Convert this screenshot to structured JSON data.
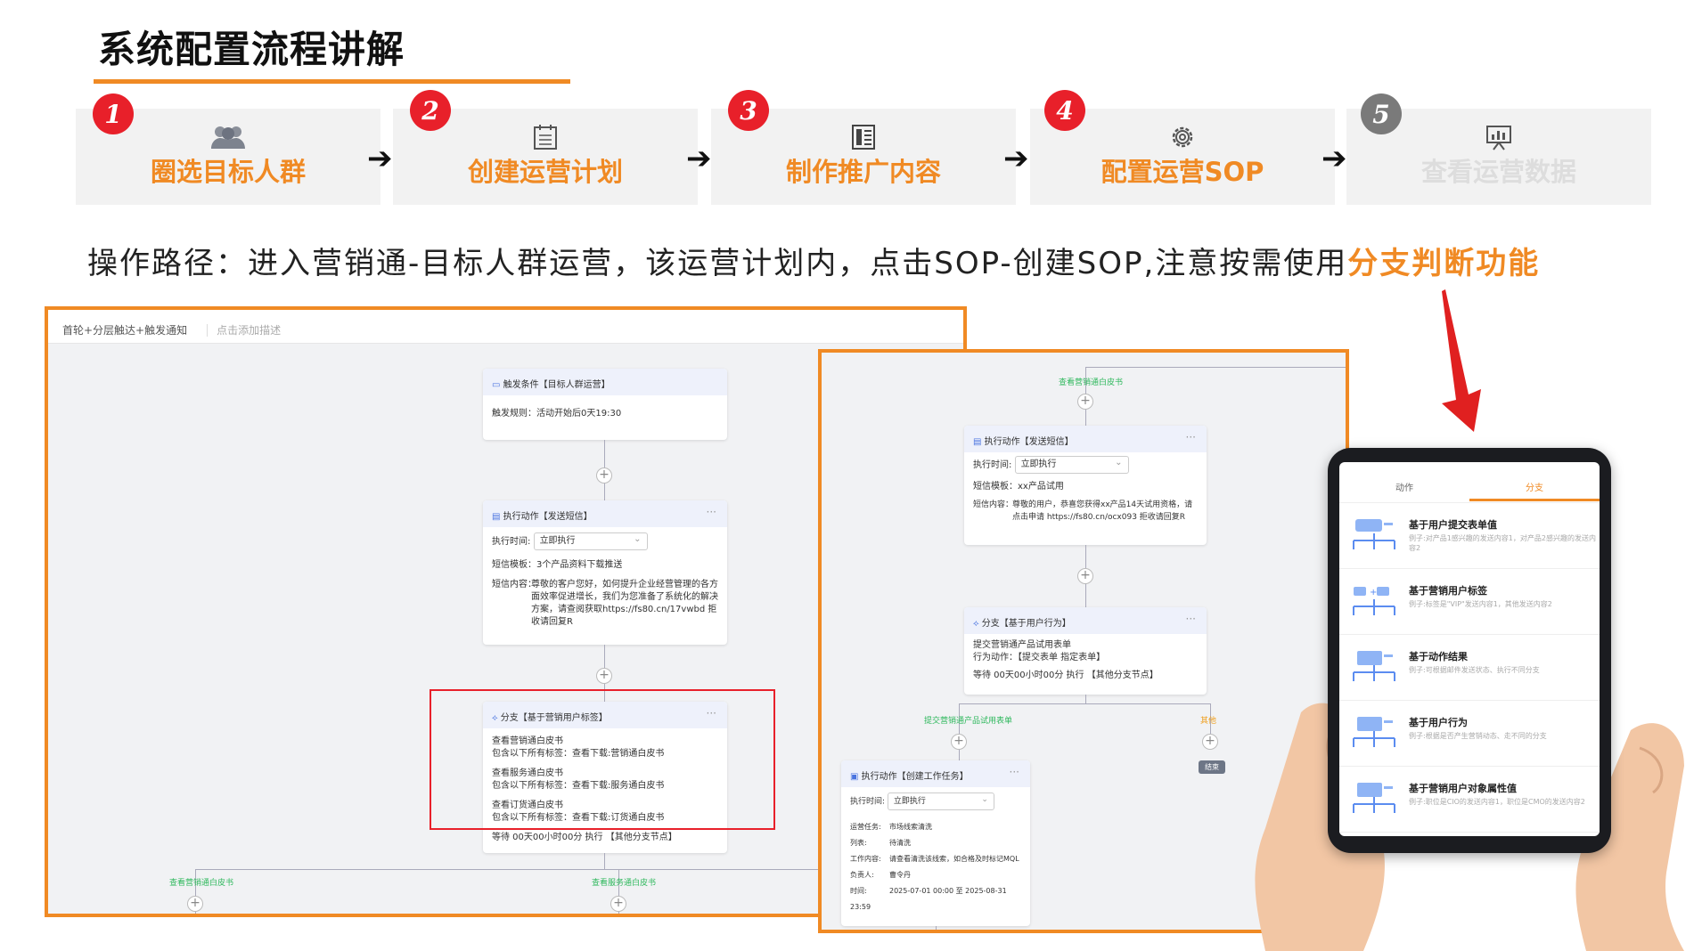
{
  "title": "系统配置流程讲解",
  "steps": [
    {
      "num": "1",
      "label": "圈选目标人群",
      "icon": "group-icon"
    },
    {
      "num": "2",
      "label": "创建运营计划",
      "icon": "calendar-list-icon"
    },
    {
      "num": "3",
      "label": "制作推广内容",
      "icon": "content-grid-icon"
    },
    {
      "num": "4",
      "label": "配置运营SOP",
      "icon": "gear-icon"
    },
    {
      "num": "5",
      "label": "查看运营数据",
      "icon": "chart-board-icon"
    }
  ],
  "path_text": "操作路径：进入营销通-目标人群运营，该运营计划内，点击SOP-创建SOP,注意按需使用",
  "path_highlight": "分支判断功能",
  "left_screen": {
    "name": "首轮+分层触达+触发通知",
    "desc_placeholder": "点击添加描述",
    "trigger_title": "触发条件【目标人群运营】",
    "trigger_rule": "触发规则：活动开始后0天19:30",
    "action_title": "执行动作【发送短信】",
    "action_time_label": "执行时间:",
    "action_time_value": "立即执行",
    "sms_template": "短信模板：3个产品资料下载推送",
    "sms_content_label": "短信内容：",
    "sms_content": "尊敬的客户您好，如何提升企业经营管理的各方面效率促进增长，我们为您准备了系统化的解决方案，请查阅获取https://fs80.cn/17vwbd 拒收请回复R",
    "branch_title": "分支【基于营销用户标签】",
    "branch_groups": [
      {
        "name": "查看营销通白皮书",
        "rule": "包含以下所有标签：查看下载:营销通白皮书"
      },
      {
        "name": "查看服务通白皮书",
        "rule": "包含以下所有标签：查看下载:服务通白皮书"
      },
      {
        "name": "查看订货通白皮书",
        "rule": "包含以下所有标签：查看下载:订货通白皮书"
      }
    ],
    "branch_wait": "等待 00天00小时00分 执行 【其他分支节点】",
    "bottom_labels": [
      "查看营销通白皮书",
      "查看服务通白皮书"
    ]
  },
  "right_screen": {
    "top_label": "查看营销通白皮书",
    "action_title": "执行动作【发送短信】",
    "action_time_label": "执行时间:",
    "action_time_value": "立即执行",
    "sms_template": "短信模板：xx产品试用",
    "sms_content_label": "短信内容：",
    "sms_content": "尊敬的用户，恭喜您获得xx产品14天试用资格，请点击申请 https://fs80.cn/ocx093 拒收请回复R",
    "branch_title": "分支【基于用户行为】",
    "branch_line1": "提交营销通产品试用表单",
    "branch_line2": "行为动作：【提交表单 指定表单】",
    "branch_wait": "等待 00天00小时00分 执行 【其他分支节点】",
    "left_branch_label": "提交营销通产品试用表单",
    "right_branch_label": "其他",
    "end_label": "结束",
    "task_title": "执行动作【创建工作任务】",
    "task_time_label": "执行时间:",
    "task_time_value": "立即执行",
    "task_rows": [
      {
        "k": "运营任务:",
        "v": "市场线索清洗"
      },
      {
        "k": "列表:",
        "v": "待清洗"
      },
      {
        "k": "工作内容:",
        "v": "请查看清洗该线索，如合格及时标记MQL"
      },
      {
        "k": "负责人:",
        "v": "曹令丹"
      },
      {
        "k": "时间:",
        "v": "2025-07-01 00:00 至 2025-08-31 23:59"
      }
    ]
  },
  "tablet": {
    "tabs": [
      "动作",
      "分支"
    ],
    "active_tab": "分支",
    "options": [
      {
        "name": "基于用户提交表单值",
        "desc": "例子:对产品1感兴趣的发送内容1，对产品2感兴趣的发送内容2"
      },
      {
        "name": "基于营销用户标签",
        "desc": "例子:标签是\"VIP\"发送内容1，其他发送内容2"
      },
      {
        "name": "基于动作结果",
        "desc": "例子:可根据邮件发送状态、执行不同分支"
      },
      {
        "name": "基于用户行为",
        "desc": "例子:根据是否产生营销动态、走不同的分支"
      },
      {
        "name": "基于营销用户对象属性值",
        "desc": "例子:职位是CIO的发送内容1，职位是CMO的发送内容2"
      }
    ]
  },
  "colors": {
    "accent": "#f08a24",
    "badge_red": "#e8202a",
    "badge_grey": "#7a7a7a",
    "branch_green": "#2eb85c"
  }
}
